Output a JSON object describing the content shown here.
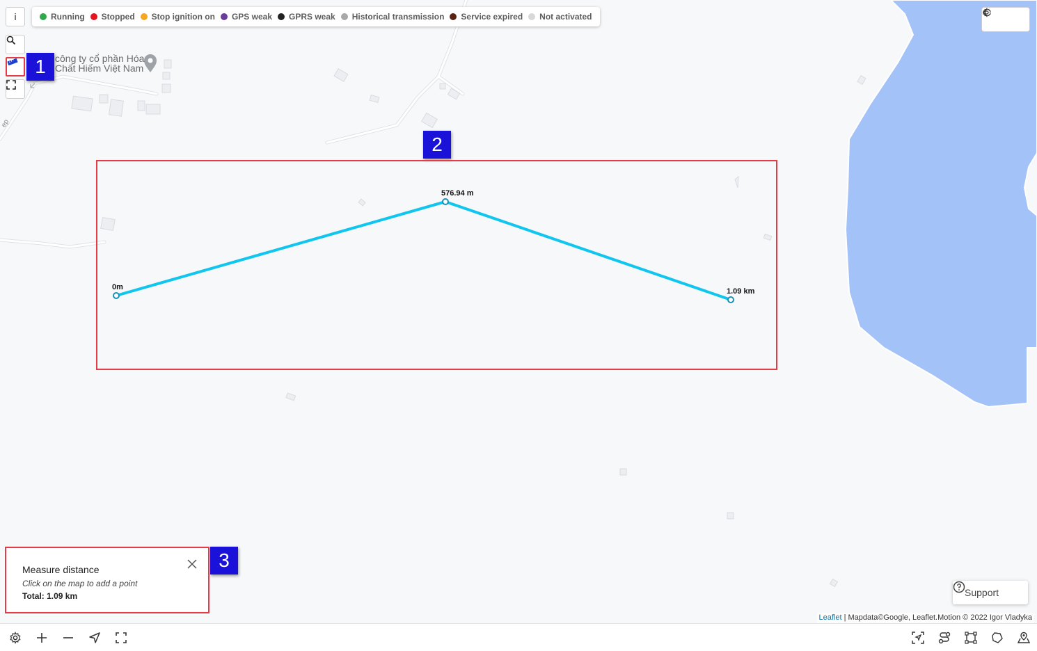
{
  "legend": {
    "items": [
      {
        "label": "Running",
        "color": "#2ea84a"
      },
      {
        "label": "Stopped",
        "color": "#e4151f"
      },
      {
        "label": "Stop ignition on",
        "color": "#f5a623"
      },
      {
        "label": "GPS weak",
        "color": "#6a3d9a"
      },
      {
        "label": "GPRS weak",
        "color": "#222222"
      },
      {
        "label": "Historical transmission",
        "color": "#a8a8a8"
      },
      {
        "label": "Service expired",
        "color": "#5a2415"
      },
      {
        "label": "Not activated",
        "color": "#d8d8d8"
      }
    ]
  },
  "map": {
    "info_button": "i",
    "poi": {
      "line1": "công ty cổ phần Hóa",
      "line2": "Chất Hiếm Việt Nam"
    },
    "road_label": "ep",
    "water_color": "#a3c2f7",
    "measure_line_color": "#10c6ee",
    "measure_labels": {
      "start": "0m",
      "mid": "576.94 m",
      "end": "1.09 km"
    }
  },
  "annotations": {
    "badge1": "1",
    "badge2": "2",
    "badge3": "3",
    "box_color": "#e53b47",
    "badge_color": "#1a12d8"
  },
  "measure_panel": {
    "title": "Measure distance",
    "hint": "Click on the map to add a point",
    "total": "Total: 1.09 km"
  },
  "support": {
    "label": "Support"
  },
  "attribution": {
    "link": "Leaflet",
    "text": " | Mapdata©Google, Leaflet.Motion © 2022 Igor Vladyka"
  },
  "toolbar": {
    "left_icons": [
      "gear-icon",
      "plus-icon",
      "minus-icon",
      "locate-icon",
      "fullscreen-icon"
    ],
    "right_icons": [
      "focus-icon",
      "route-icon",
      "area-icon",
      "geofence-icon",
      "map-layers-icon"
    ]
  }
}
